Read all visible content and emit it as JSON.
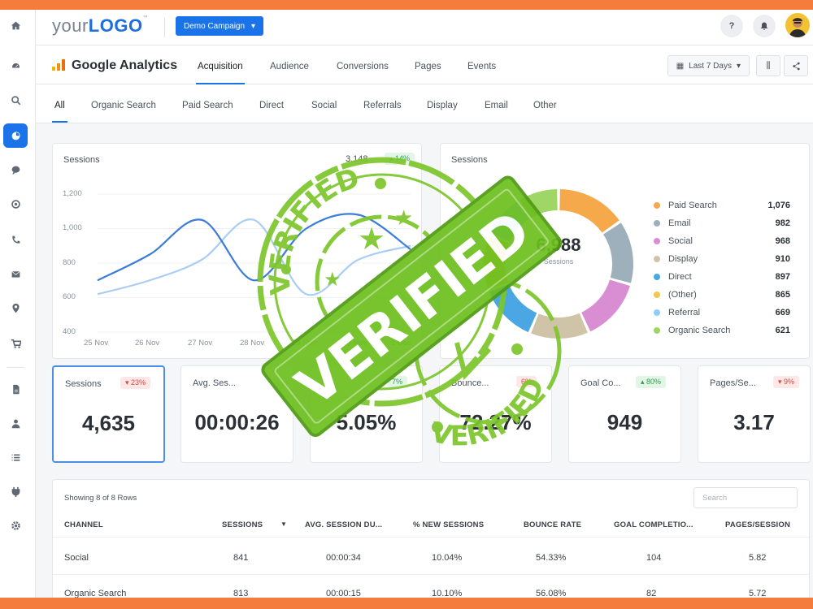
{
  "topbar": {
    "logo_prefix": "your",
    "logo_main": "LOGO",
    "logo_tm": "™",
    "campaign_label": "Demo Campaign",
    "help": "?"
  },
  "header": {
    "title": "Google Analytics",
    "tabs": [
      "Acquisition",
      "Audience",
      "Conversions",
      "Pages",
      "Events"
    ],
    "date_range": "Last 7 Days"
  },
  "channel_tabs": [
    "All",
    "Organic Search",
    "Paid Search",
    "Direct",
    "Social",
    "Referrals",
    "Display",
    "Email",
    "Other"
  ],
  "line_chart": {
    "label": "Sessions",
    "value": "3,148",
    "badge": "14%"
  },
  "chart_data": [
    {
      "type": "line",
      "title": "Sessions",
      "x": [
        "25 Nov",
        "26 Nov",
        "27 Nov",
        "28 Nov",
        "29 Nov",
        "30 Nov",
        "1 Dec"
      ],
      "series": [
        {
          "values": [
            700,
            850,
            1050,
            700,
            1000,
            1080,
            880
          ],
          "color": "#3b7dd8"
        },
        {
          "values": [
            620,
            700,
            820,
            1050,
            620,
            820,
            900
          ],
          "color": "#a9cdf3"
        }
      ],
      "ylim": [
        400,
        1200
      ],
      "yticks": [
        "400",
        "600",
        "800",
        "1,000",
        "1,200"
      ]
    },
    {
      "type": "pie",
      "title": "Sessions",
      "center_value": "6,988",
      "center_label": "Sessions",
      "categories": [
        "Paid Search",
        "Email",
        "Social",
        "Display",
        "Direct",
        "(Other)",
        "Referral",
        "Organic Search"
      ],
      "values": [
        1076,
        982,
        968,
        910,
        897,
        865,
        669,
        621
      ],
      "value_labels": [
        "1,076",
        "982",
        "968",
        "910",
        "897",
        "865",
        "669",
        "621"
      ],
      "colors": [
        "#f6a94b",
        "#9fb0bd",
        "#d98ed3",
        "#cfc4a8",
        "#4aa7e3",
        "#f2c94c",
        "#8fcdf6",
        "#9ed765"
      ]
    }
  ],
  "kpis": [
    {
      "label": "Sessions",
      "badge": "▾ 23%",
      "trend": "down",
      "value": "4,635"
    },
    {
      "label": "Avg. Ses...",
      "badge": "",
      "trend": "",
      "value": "00:00:26"
    },
    {
      "label": "",
      "badge": "7%",
      "trend": "up",
      "value": "5.05%"
    },
    {
      "label": "Bounce...",
      "badge": "6%",
      "trend": "down",
      "value": "72.27%"
    },
    {
      "label": "Goal Co...",
      "badge": "▴ 80%",
      "trend": "up",
      "value": "949"
    },
    {
      "label": "Pages/Se...",
      "badge": "▾ 9%",
      "trend": "down",
      "value": "3.17"
    }
  ],
  "table": {
    "showing": "Showing 8 of 8 Rows",
    "search_placeholder": "Search",
    "headers": [
      "CHANNEL",
      "SESSIONS",
      "AVG. SESSION DU...",
      "% NEW SESSIONS",
      "BOUNCE RATE",
      "GOAL COMPLETIO...",
      "PAGES/SESSION"
    ],
    "rows": [
      [
        "Social",
        "841",
        "00:00:34",
        "10.04%",
        "54.33%",
        "104",
        "5.82"
      ],
      [
        "Organic Search",
        "813",
        "00:00:15",
        "10.10%",
        "56.08%",
        "82",
        "5.72"
      ]
    ]
  },
  "stamp": {
    "main": "VERIFIED",
    "arc_text": "VERIFIED",
    "color": "#6fc220"
  }
}
